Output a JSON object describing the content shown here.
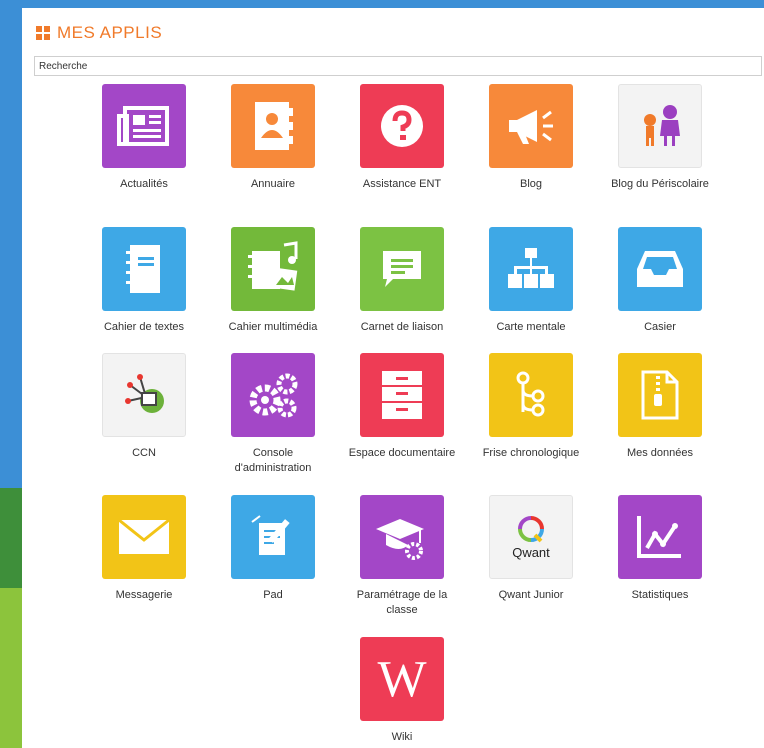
{
  "header": {
    "title": "MES APPLIS"
  },
  "search": {
    "placeholder": "Recherche"
  },
  "apps": [
    {
      "label": "Actualités",
      "icon": "newspaper-icon",
      "color": "#a347c7"
    },
    {
      "label": "Annuaire",
      "icon": "address-book-icon",
      "color": "#f7893a"
    },
    {
      "label": "Assistance ENT",
      "icon": "help-icon",
      "color": "#ee3c55"
    },
    {
      "label": "Blog",
      "icon": "megaphone-icon",
      "color": "#f7893a"
    },
    {
      "label": "Blog du Périscolaire",
      "icon": "children-icon",
      "color": "#f3f3f3"
    },
    {
      "label": "Cahier de textes",
      "icon": "notebook-icon",
      "color": "#3ea8e6"
    },
    {
      "label": "Cahier multimédia",
      "icon": "multimedia-icon",
      "color": "#73b93a"
    },
    {
      "label": "Carnet de liaison",
      "icon": "message-icon",
      "color": "#7cc243"
    },
    {
      "label": "Carte mentale",
      "icon": "mindmap-icon",
      "color": "#3ea8e6"
    },
    {
      "label": "Casier",
      "icon": "inbox-icon",
      "color": "#3ea8e6"
    },
    {
      "label": "CCN",
      "icon": "ccn-icon",
      "color": "#f3f3f3"
    },
    {
      "label": "Console d'administration",
      "icon": "gears-icon",
      "color": "#a347c7"
    },
    {
      "label": "Espace documentaire",
      "icon": "drawers-icon",
      "color": "#ee3c55"
    },
    {
      "label": "Frise chronologique",
      "icon": "timeline-icon",
      "color": "#f2c417"
    },
    {
      "label": "Mes données",
      "icon": "zip-file-icon",
      "color": "#f2c417"
    },
    {
      "label": "Messagerie",
      "icon": "envelope-icon",
      "color": "#f2c417"
    },
    {
      "label": "Pad",
      "icon": "pad-icon",
      "color": "#3ea8e6"
    },
    {
      "label": "Paramétrage de la classe",
      "icon": "graduation-icon",
      "color": "#a347c7"
    },
    {
      "label": "Qwant Junior",
      "icon": "qwant-icon",
      "color": "#f3f3f3",
      "text": "Qwant"
    },
    {
      "label": "Statistiques",
      "icon": "chart-icon",
      "color": "#a347c7"
    },
    {
      "label": "Wiki",
      "icon": "wiki-icon",
      "color": "#ee3c55",
      "text": "W"
    }
  ]
}
